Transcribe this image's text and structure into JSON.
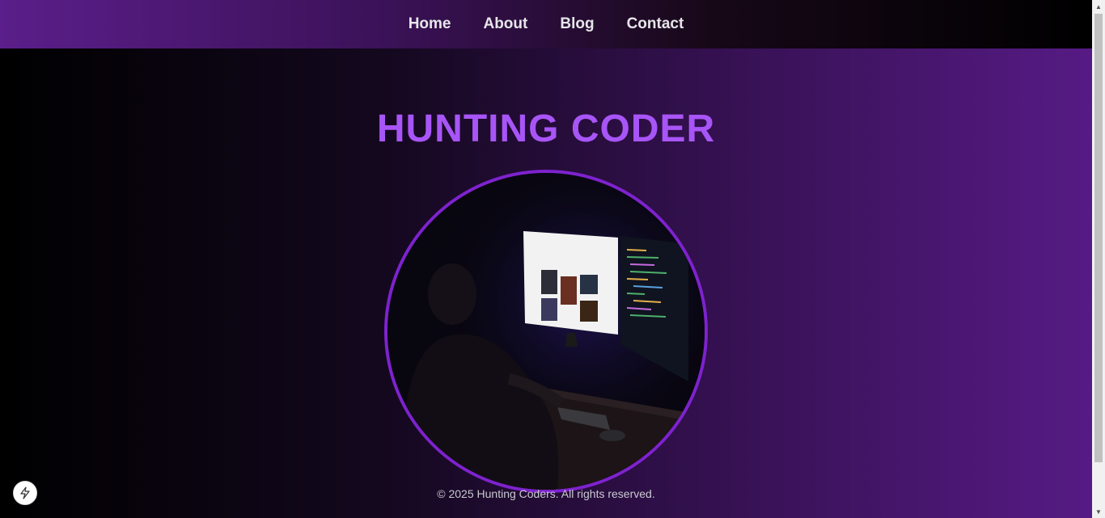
{
  "nav": {
    "items": [
      {
        "label": "Home"
      },
      {
        "label": "About"
      },
      {
        "label": "Blog"
      },
      {
        "label": "Contact"
      }
    ]
  },
  "hero": {
    "title": "HUNTING CODER",
    "image_icon": "coder-at-desk-image"
  },
  "footer": {
    "text": "© 2025 Hunting Coders. All rights reserved."
  },
  "colors": {
    "accent": "#a855f7",
    "ring": "#7e22ce",
    "nav_gradient_start": "#5b1e8a",
    "page_gradient_end": "#571b86"
  },
  "dev_indicator": {
    "icon": "lightning-bolt-icon"
  }
}
